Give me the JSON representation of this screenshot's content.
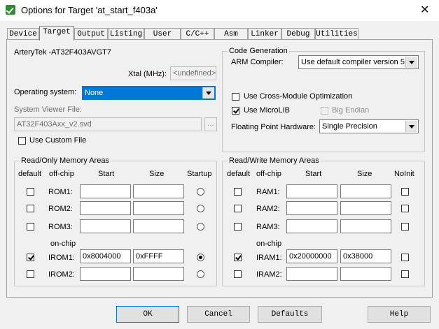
{
  "window": {
    "title": "Options for Target 'at_start_f403a'"
  },
  "tabs": [
    {
      "label": "Device"
    },
    {
      "label": "Target"
    },
    {
      "label": "Output"
    },
    {
      "label": "Listing"
    },
    {
      "label": "User"
    },
    {
      "label": "C/C++"
    },
    {
      "label": "Asm"
    },
    {
      "label": "Linker"
    },
    {
      "label": "Debug"
    },
    {
      "label": "Utilities"
    }
  ],
  "device_name": "ArteryTek -AT32F403AVGT7",
  "xtal": {
    "label": "Xtal (MHz):",
    "value": "<undefined>"
  },
  "os": {
    "label": "Operating system:",
    "value": "None"
  },
  "svd": {
    "label": "System Viewer File:",
    "value": "AT32F403Axx_v2.svd",
    "browse": "..."
  },
  "use_custom_file": {
    "label": "Use Custom File",
    "checked": false
  },
  "codegen": {
    "title": "Code Generation",
    "compiler_label": "ARM Compiler:",
    "compiler_value": "Use default compiler version 5",
    "cross_module": {
      "label": "Use Cross-Module Optimization",
      "checked": false
    },
    "microlib": {
      "label": "Use MicroLIB",
      "checked": true
    },
    "big_endian": {
      "label": "Big Endian",
      "checked": false
    },
    "fpu_label": "Floating Point Hardware:",
    "fpu_value": "Single Precision"
  },
  "ro_mem": {
    "title": "Read/Only Memory Areas",
    "headers": {
      "default": "default",
      "offchip": "off-chip",
      "start": "Start",
      "size": "Size",
      "last": "Startup"
    },
    "onchip_label": "on-chip",
    "rows": [
      {
        "name": "ROM1:",
        "default": false,
        "start": "",
        "size": "",
        "selected": false
      },
      {
        "name": "ROM2:",
        "default": false,
        "start": "",
        "size": "",
        "selected": false
      },
      {
        "name": "ROM3:",
        "default": false,
        "start": "",
        "size": "",
        "selected": false
      },
      {
        "name": "IROM1:",
        "default": true,
        "start": "0x8004000",
        "size": "0xFFFF",
        "selected": true
      },
      {
        "name": "IROM2:",
        "default": false,
        "start": "",
        "size": "",
        "selected": false
      }
    ]
  },
  "rw_mem": {
    "title": "Read/Write Memory Areas",
    "headers": {
      "default": "default",
      "offchip": "off-chip",
      "start": "Start",
      "size": "Size",
      "last": "NoInit"
    },
    "onchip_label": "on-chip",
    "rows": [
      {
        "name": "RAM1:",
        "default": false,
        "start": "",
        "size": "",
        "noinit": false
      },
      {
        "name": "RAM2:",
        "default": false,
        "start": "",
        "size": "",
        "noinit": false
      },
      {
        "name": "RAM3:",
        "default": false,
        "start": "",
        "size": "",
        "noinit": false
      },
      {
        "name": "IRAM1:",
        "default": true,
        "start": "0x20000000",
        "size": "0x38000",
        "noinit": false
      },
      {
        "name": "IRAM2:",
        "default": false,
        "start": "",
        "size": "",
        "noinit": false
      }
    ]
  },
  "buttons": {
    "ok": "OK",
    "cancel": "Cancel",
    "defaults": "Defaults",
    "help": "Help"
  }
}
